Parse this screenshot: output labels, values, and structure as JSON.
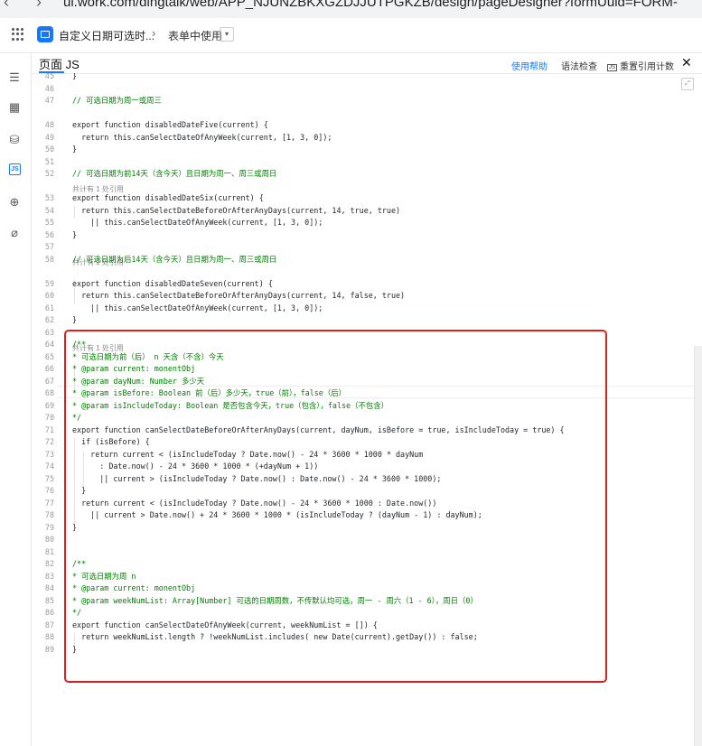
{
  "browser": {
    "url": "ui.work.com/dingtalk/web/APP_NJUNZBKXGZDJJUTPGKZB/design/pageDesigner?formUuid=FORM-"
  },
  "header": {
    "app_title": "自定义日期可选时...",
    "breadcrumb_separator": "›",
    "page_name": "表单中使用",
    "dropdown_caret": "▾"
  },
  "panel": {
    "tab_label": "页面 JS",
    "help_label": "使用帮助",
    "lint_label": "语法检查",
    "recount_icon_text": "JS",
    "recount_label": "重置引用计数",
    "close_glyph": "✕"
  },
  "editor": {
    "expand_glyph": "⤢",
    "lines": [
      {
        "n": "45",
        "text": "}",
        "type": "code"
      },
      {
        "n": "46",
        "text": "",
        "type": "code"
      },
      {
        "n": "47",
        "text": "// 可选日期为周一或周三",
        "type": "comment"
      },
      {
        "n": "48",
        "text": "export function disabledDateFive(current) {",
        "type": "code"
      },
      {
        "n": "49",
        "text": "  return this.canSelectDateOfAnyWeek(current, [1, 3, 0]);",
        "type": "code"
      },
      {
        "n": "50",
        "text": "}",
        "type": "code"
      },
      {
        "n": "51",
        "text": "",
        "type": "code"
      },
      {
        "n": "52",
        "text": "// 可选日期为前14天（含今天）且日期为周一、周三或周日",
        "type": "comment"
      },
      {
        "n": "53",
        "text": "export function disabledDateSix(current) {",
        "type": "code"
      },
      {
        "n": "54",
        "text": "  return this.canSelectDateBeforeOrAfterAnyDays(current, 14, true, true)",
        "type": "code"
      },
      {
        "n": "55",
        "text": "    || this.canSelectDateOfAnyWeek(current, [1, 3, 0]);",
        "type": "code"
      },
      {
        "n": "56",
        "text": "}",
        "type": "code"
      },
      {
        "n": "57",
        "text": "",
        "type": "code"
      },
      {
        "n": "58",
        "text": "// 可选日期为后14天（含今天）且日期为周一、周三或周日",
        "type": "comment"
      },
      {
        "n": "59",
        "text": "export function disabledDateSeven(current) {",
        "type": "code"
      },
      {
        "n": "60",
        "text": "  return this.canSelectDateBeforeOrAfterAnyDays(current, 14, false, true)",
        "type": "code"
      },
      {
        "n": "61",
        "text": "    || this.canSelectDateOfAnyWeek(current, [1, 3, 0]);",
        "type": "code"
      },
      {
        "n": "62",
        "text": "}",
        "type": "code"
      },
      {
        "n": "63",
        "text": "",
        "type": "code"
      },
      {
        "n": "64",
        "text": "/**",
        "type": "comment"
      },
      {
        "n": "65",
        "text": "* 可选日期为前（后） n 天含（不含）今天",
        "type": "comment"
      },
      {
        "n": "66",
        "text": "* @param current: monentObj",
        "type": "comment"
      },
      {
        "n": "67",
        "text": "* @param dayNum: Number 多少天",
        "type": "comment"
      },
      {
        "n": "68",
        "text": "* @param isBefore: Boolean 前（后）多少天，true（前），false（后）",
        "type": "comment"
      },
      {
        "n": "69",
        "text": "* @param isIncludeToday: Boolean 是否包含今天，true（包含），false（不包含）",
        "type": "comment"
      },
      {
        "n": "70",
        "text": "*/",
        "type": "comment"
      },
      {
        "n": "71",
        "text": "export function canSelectDateBeforeOrAfterAnyDays(current, dayNum, isBefore = true, isIncludeToday = true) {",
        "type": "code"
      },
      {
        "n": "72",
        "text": "  if (isBefore) {",
        "type": "code"
      },
      {
        "n": "73",
        "text": "    return current < (isIncludeToday ? Date.now() - 24 * 3600 * 1000 * dayNum",
        "type": "code"
      },
      {
        "n": "74",
        "text": "      : Date.now() - 24 * 3600 * 1000 * (+dayNum + 1))",
        "type": "code"
      },
      {
        "n": "75",
        "text": "      || current > (isIncludeToday ? Date.now() : Date.now() - 24 * 3600 * 1000);",
        "type": "code"
      },
      {
        "n": "76",
        "text": "  }",
        "type": "code"
      },
      {
        "n": "77",
        "text": "  return current < (isIncludeToday ? Date.now() - 24 * 3600 * 1000 : Date.now())",
        "type": "code"
      },
      {
        "n": "78",
        "text": "    || current > Date.now() + 24 * 3600 * 1000 * (isIncludeToday ? (dayNum - 1) : dayNum);",
        "type": "code"
      },
      {
        "n": "79",
        "text": "}",
        "type": "code"
      },
      {
        "n": "80",
        "text": "",
        "type": "code"
      },
      {
        "n": "81",
        "text": "",
        "type": "code"
      },
      {
        "n": "82",
        "text": "/**",
        "type": "comment"
      },
      {
        "n": "83",
        "text": "* 可选日期为周 n",
        "type": "comment"
      },
      {
        "n": "84",
        "text": "* @param current: monentObj",
        "type": "comment"
      },
      {
        "n": "85",
        "text": "* @param weekNumList: Array[Number] 可选的日期周数，不传默认均可选，周一 - 周六（1 - 6），周日（0）",
        "type": "comment"
      },
      {
        "n": "86",
        "text": "*/",
        "type": "comment"
      },
      {
        "n": "87",
        "text": "export function canSelectDateOfAnyWeek(current, weekNumList = []) {",
        "type": "code"
      },
      {
        "n": "88",
        "text": "  return weekNumList.length ? !weekNumList.includes( new Date(current).getDay()) : false;",
        "type": "code"
      },
      {
        "n": "89",
        "text": "}",
        "type": "code"
      }
    ],
    "codelens": [
      "共计有 1 处引用",
      "共计有 1 处引用",
      "共计有 1 处引用"
    ]
  }
}
